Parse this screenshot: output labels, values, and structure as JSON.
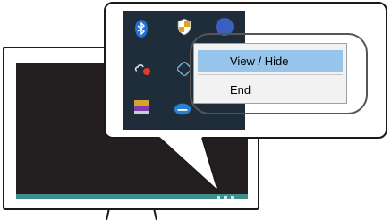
{
  "context_menu": {
    "items": [
      {
        "label": "View / Hide",
        "highlighted": true
      },
      {
        "label": "End",
        "highlighted": false
      }
    ]
  },
  "tray_icons": [
    {
      "name": "bluetooth-icon",
      "color": "#1e73d8"
    },
    {
      "name": "security-shield-icon",
      "color": "#ffffff"
    },
    {
      "name": "app-icon-partial",
      "color": "#3a5fbf"
    },
    {
      "name": "cloud-sync-icon",
      "color": "#e23b2e"
    },
    {
      "name": "network-icon",
      "color": "#6ab0d8"
    },
    {
      "name": "media-app-icon",
      "color": "#d8a030"
    },
    {
      "name": "disk-app-icon",
      "color": "#2a7fd0"
    }
  ],
  "colors": {
    "screen": "#231f20",
    "taskbar": "#3e8e8c",
    "tray_background": "#1f2d3a",
    "menu_highlight": "#96c4ea"
  }
}
